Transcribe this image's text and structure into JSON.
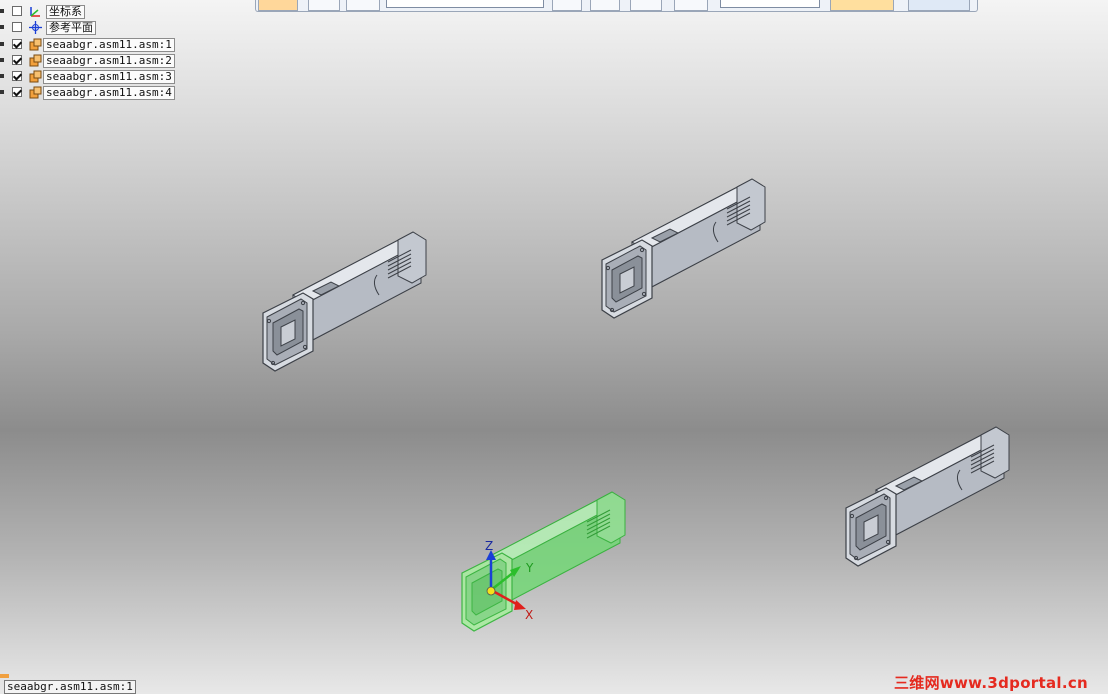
{
  "tree": {
    "items": [
      {
        "label": "坐标系",
        "checked": false,
        "icon": "coordinate-system-icon"
      },
      {
        "label": "参考平面",
        "checked": false,
        "icon": "reference-plane-icon"
      },
      {
        "label": "seaabgr.asm11.asm:1",
        "checked": true,
        "icon": "assembly-icon"
      },
      {
        "label": "seaabgr.asm11.asm:2",
        "checked": true,
        "icon": "assembly-icon"
      },
      {
        "label": "seaabgr.asm11.asm:3",
        "checked": true,
        "icon": "assembly-icon"
      },
      {
        "label": "seaabgr.asm11.asm:4",
        "checked": true,
        "icon": "assembly-icon"
      }
    ]
  },
  "viewport": {
    "axes": {
      "z": "Z",
      "y": "Y",
      "x": "X"
    },
    "colors": {
      "part_body": "#c9ced6",
      "part_edge": "#3d4148",
      "selected": "#3fd04a",
      "axis_x": "#e0201d",
      "axis_y": "#2cbe2c",
      "axis_z": "#1a3fd6"
    }
  },
  "status": {
    "selected_item": "seaabgr.asm11.asm:1"
  },
  "watermark": "三维网www.3dportal.cn"
}
